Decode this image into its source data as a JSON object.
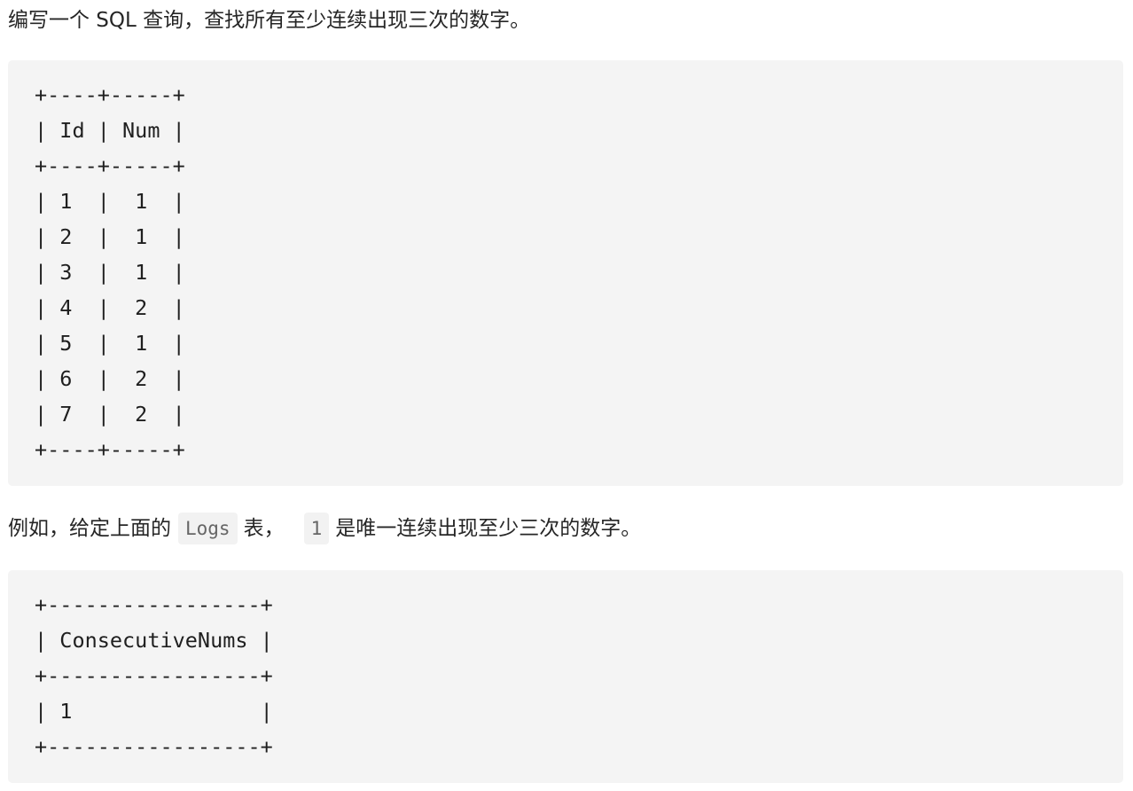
{
  "problem": {
    "intro": "编写一个 SQL 查询，查找所有至少连续出现三次的数字。",
    "input_table_lines": [
      "+----+-----+",
      "| Id | Num |",
      "+----+-----+",
      "| 1  |  1  |",
      "| 2  |  1  |",
      "| 3  |  1  |",
      "| 4  |  2  |",
      "| 5  |  1  |",
      "| 6  |  2  |",
      "| 7  |  2  |",
      "+----+-----+"
    ],
    "example": {
      "prefix": "例如，给定上面的",
      "table_name": "Logs",
      "middle": "表，",
      "value": "1",
      "suffix": "是唯一连续出现至少三次的数字。"
    },
    "output_table_lines": [
      "+-----------------+",
      "| ConsecutiveNums |",
      "+-----------------+",
      "| 1               |",
      "+-----------------+"
    ]
  }
}
